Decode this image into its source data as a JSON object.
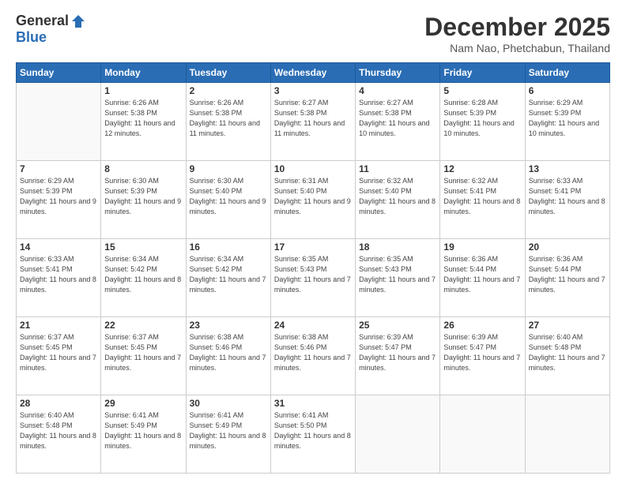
{
  "header": {
    "logo_general": "General",
    "logo_blue": "Blue",
    "title": "December 2025",
    "location": "Nam Nao, Phetchabun, Thailand"
  },
  "days_of_week": [
    "Sunday",
    "Monday",
    "Tuesday",
    "Wednesday",
    "Thursday",
    "Friday",
    "Saturday"
  ],
  "weeks": [
    [
      {
        "day": "",
        "sunrise": "",
        "sunset": "",
        "daylight": ""
      },
      {
        "day": "1",
        "sunrise": "Sunrise: 6:26 AM",
        "sunset": "Sunset: 5:38 PM",
        "daylight": "Daylight: 11 hours and 12 minutes."
      },
      {
        "day": "2",
        "sunrise": "Sunrise: 6:26 AM",
        "sunset": "Sunset: 5:38 PM",
        "daylight": "Daylight: 11 hours and 11 minutes."
      },
      {
        "day": "3",
        "sunrise": "Sunrise: 6:27 AM",
        "sunset": "Sunset: 5:38 PM",
        "daylight": "Daylight: 11 hours and 11 minutes."
      },
      {
        "day": "4",
        "sunrise": "Sunrise: 6:27 AM",
        "sunset": "Sunset: 5:38 PM",
        "daylight": "Daylight: 11 hours and 10 minutes."
      },
      {
        "day": "5",
        "sunrise": "Sunrise: 6:28 AM",
        "sunset": "Sunset: 5:39 PM",
        "daylight": "Daylight: 11 hours and 10 minutes."
      },
      {
        "day": "6",
        "sunrise": "Sunrise: 6:29 AM",
        "sunset": "Sunset: 5:39 PM",
        "daylight": "Daylight: 11 hours and 10 minutes."
      }
    ],
    [
      {
        "day": "7",
        "sunrise": "Sunrise: 6:29 AM",
        "sunset": "Sunset: 5:39 PM",
        "daylight": "Daylight: 11 hours and 9 minutes."
      },
      {
        "day": "8",
        "sunrise": "Sunrise: 6:30 AM",
        "sunset": "Sunset: 5:39 PM",
        "daylight": "Daylight: 11 hours and 9 minutes."
      },
      {
        "day": "9",
        "sunrise": "Sunrise: 6:30 AM",
        "sunset": "Sunset: 5:40 PM",
        "daylight": "Daylight: 11 hours and 9 minutes."
      },
      {
        "day": "10",
        "sunrise": "Sunrise: 6:31 AM",
        "sunset": "Sunset: 5:40 PM",
        "daylight": "Daylight: 11 hours and 9 minutes."
      },
      {
        "day": "11",
        "sunrise": "Sunrise: 6:32 AM",
        "sunset": "Sunset: 5:40 PM",
        "daylight": "Daylight: 11 hours and 8 minutes."
      },
      {
        "day": "12",
        "sunrise": "Sunrise: 6:32 AM",
        "sunset": "Sunset: 5:41 PM",
        "daylight": "Daylight: 11 hours and 8 minutes."
      },
      {
        "day": "13",
        "sunrise": "Sunrise: 6:33 AM",
        "sunset": "Sunset: 5:41 PM",
        "daylight": "Daylight: 11 hours and 8 minutes."
      }
    ],
    [
      {
        "day": "14",
        "sunrise": "Sunrise: 6:33 AM",
        "sunset": "Sunset: 5:41 PM",
        "daylight": "Daylight: 11 hours and 8 minutes."
      },
      {
        "day": "15",
        "sunrise": "Sunrise: 6:34 AM",
        "sunset": "Sunset: 5:42 PM",
        "daylight": "Daylight: 11 hours and 8 minutes."
      },
      {
        "day": "16",
        "sunrise": "Sunrise: 6:34 AM",
        "sunset": "Sunset: 5:42 PM",
        "daylight": "Daylight: 11 hours and 7 minutes."
      },
      {
        "day": "17",
        "sunrise": "Sunrise: 6:35 AM",
        "sunset": "Sunset: 5:43 PM",
        "daylight": "Daylight: 11 hours and 7 minutes."
      },
      {
        "day": "18",
        "sunrise": "Sunrise: 6:35 AM",
        "sunset": "Sunset: 5:43 PM",
        "daylight": "Daylight: 11 hours and 7 minutes."
      },
      {
        "day": "19",
        "sunrise": "Sunrise: 6:36 AM",
        "sunset": "Sunset: 5:44 PM",
        "daylight": "Daylight: 11 hours and 7 minutes."
      },
      {
        "day": "20",
        "sunrise": "Sunrise: 6:36 AM",
        "sunset": "Sunset: 5:44 PM",
        "daylight": "Daylight: 11 hours and 7 minutes."
      }
    ],
    [
      {
        "day": "21",
        "sunrise": "Sunrise: 6:37 AM",
        "sunset": "Sunset: 5:45 PM",
        "daylight": "Daylight: 11 hours and 7 minutes."
      },
      {
        "day": "22",
        "sunrise": "Sunrise: 6:37 AM",
        "sunset": "Sunset: 5:45 PM",
        "daylight": "Daylight: 11 hours and 7 minutes."
      },
      {
        "day": "23",
        "sunrise": "Sunrise: 6:38 AM",
        "sunset": "Sunset: 5:46 PM",
        "daylight": "Daylight: 11 hours and 7 minutes."
      },
      {
        "day": "24",
        "sunrise": "Sunrise: 6:38 AM",
        "sunset": "Sunset: 5:46 PM",
        "daylight": "Daylight: 11 hours and 7 minutes."
      },
      {
        "day": "25",
        "sunrise": "Sunrise: 6:39 AM",
        "sunset": "Sunset: 5:47 PM",
        "daylight": "Daylight: 11 hours and 7 minutes."
      },
      {
        "day": "26",
        "sunrise": "Sunrise: 6:39 AM",
        "sunset": "Sunset: 5:47 PM",
        "daylight": "Daylight: 11 hours and 7 minutes."
      },
      {
        "day": "27",
        "sunrise": "Sunrise: 6:40 AM",
        "sunset": "Sunset: 5:48 PM",
        "daylight": "Daylight: 11 hours and 7 minutes."
      }
    ],
    [
      {
        "day": "28",
        "sunrise": "Sunrise: 6:40 AM",
        "sunset": "Sunset: 5:48 PM",
        "daylight": "Daylight: 11 hours and 8 minutes."
      },
      {
        "day": "29",
        "sunrise": "Sunrise: 6:41 AM",
        "sunset": "Sunset: 5:49 PM",
        "daylight": "Daylight: 11 hours and 8 minutes."
      },
      {
        "day": "30",
        "sunrise": "Sunrise: 6:41 AM",
        "sunset": "Sunset: 5:49 PM",
        "daylight": "Daylight: 11 hours and 8 minutes."
      },
      {
        "day": "31",
        "sunrise": "Sunrise: 6:41 AM",
        "sunset": "Sunset: 5:50 PM",
        "daylight": "Daylight: 11 hours and 8 minutes."
      },
      {
        "day": "",
        "sunrise": "",
        "sunset": "",
        "daylight": ""
      },
      {
        "day": "",
        "sunrise": "",
        "sunset": "",
        "daylight": ""
      },
      {
        "day": "",
        "sunrise": "",
        "sunset": "",
        "daylight": ""
      }
    ]
  ]
}
